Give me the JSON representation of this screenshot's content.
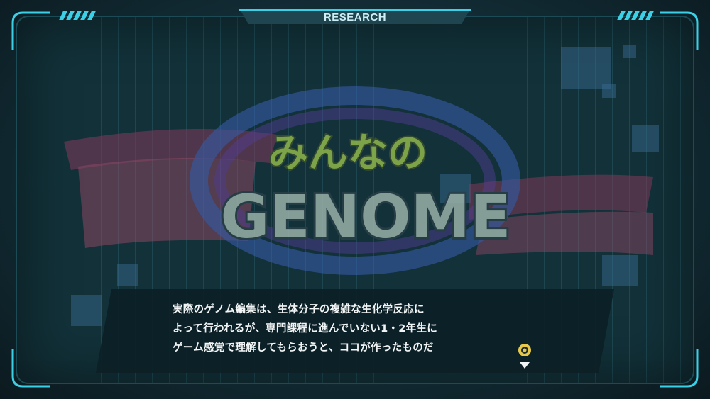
{
  "screen": {
    "header": {
      "title": "RESEARCH"
    },
    "background_logo": {
      "line1": "みんなの",
      "line2": "GENOME"
    },
    "dialog": {
      "lines": [
        "実際のゲノム編集は、生体分子の複雑な生化学反応に",
        "よって行われるが、専門課程に進んでいない1・2年生に",
        "ゲーム感覚で理解してもらおうと、ココが作ったものだ"
      ],
      "advance_icon": "next-arrow-icon"
    },
    "colors": {
      "accent": "#3bd0e6",
      "panel": "#123139",
      "text": "#f2f5f5"
    }
  }
}
